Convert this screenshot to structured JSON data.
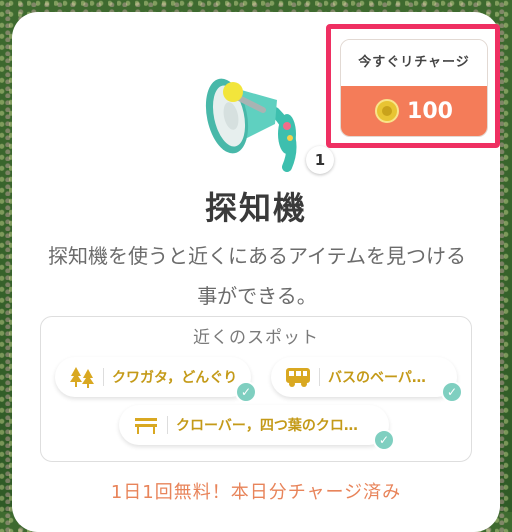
{
  "item": {
    "name": "探知機",
    "count": "1",
    "description": "探知機を使うと近くにあるアイテムを見つける事ができる。"
  },
  "recharge": {
    "label": "今すぐリチャージ",
    "price": "100",
    "highlight_color": "#ef2f62",
    "price_bg_color": "#f47c59"
  },
  "spots": {
    "title": "近くのスポット",
    "items": [
      {
        "label": "クワガタ，どんぐり",
        "icon": "trees-icon",
        "checked": true
      },
      {
        "label": "バスのベーパ…",
        "icon": "bus-icon",
        "checked": true
      },
      {
        "label": "クローバー，四つ葉のクロ…",
        "icon": "bench-icon",
        "checked": true
      }
    ]
  },
  "footer": {
    "status": "1日1回無料！本日分チャージ済み"
  }
}
